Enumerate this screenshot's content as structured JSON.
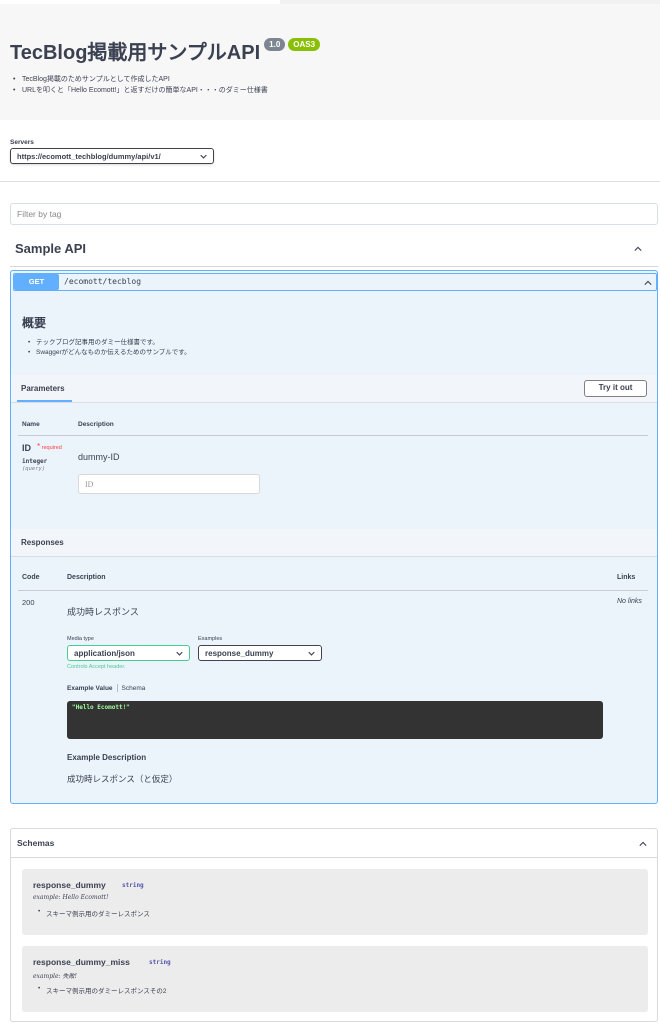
{
  "info": {
    "title": "TecBlog掲載用サンプルAPI",
    "version": "1.0",
    "oas": "OAS3",
    "description": [
      "TecBlog掲載のためサンプルとして作成したAPI",
      "URLを叩くと「Hello Ecomott!」と返すだけの簡単なAPI・・・のダミー仕様書"
    ]
  },
  "servers": {
    "label": "Servers",
    "selected": "https://ecomott_techblog/dummy/api/v1/"
  },
  "filter": {
    "placeholder": "Filter by tag"
  },
  "tag": {
    "name": "Sample API"
  },
  "operation": {
    "method": "GET",
    "path": "/ecomott/tecblog",
    "heading": "概要",
    "description": [
      "テックブログ記事用のダミー仕様書です。",
      "Swaggerがどんなものか伝えるためのサンプルです。"
    ],
    "parameters_tab": "Parameters",
    "try_label": "Try it out",
    "param_headers": {
      "name": "Name",
      "description": "Description"
    },
    "param": {
      "name": "ID",
      "required_mark": "*",
      "required_label": "required",
      "type": "integer",
      "in": "(query)",
      "description": "dummy-ID",
      "placeholder": "ID"
    },
    "responses": {
      "title": "Responses",
      "headers": {
        "code": "Code",
        "description": "Description",
        "links": "Links"
      },
      "code": "200",
      "description": "成功時レスポンス",
      "links": "No links",
      "media_type_label": "Media type",
      "media_type": "application/json",
      "examples_label": "Examples",
      "example": "response_dummy",
      "accept_note": "Controls Accept header.",
      "example_value_tab": "Example Value",
      "schema_tab": "Schema",
      "example_code": "\"Hello Ecomott!\"",
      "example_desc_heading": "Example Description",
      "example_desc": "成功時レスポンス（と仮定）"
    }
  },
  "schemas": {
    "title": "Schemas",
    "models": [
      {
        "name": "response_dummy",
        "type": "string",
        "example_label": "example:",
        "example": "Hello Ecomott!",
        "description": "スキーマ例示用のダミーレスポンス"
      },
      {
        "name": "response_dummy_miss",
        "type": "string",
        "example_label": "example:",
        "example": "失敗!",
        "description": "スキーマ例示用のダミーレスポンスその2"
      }
    ]
  }
}
